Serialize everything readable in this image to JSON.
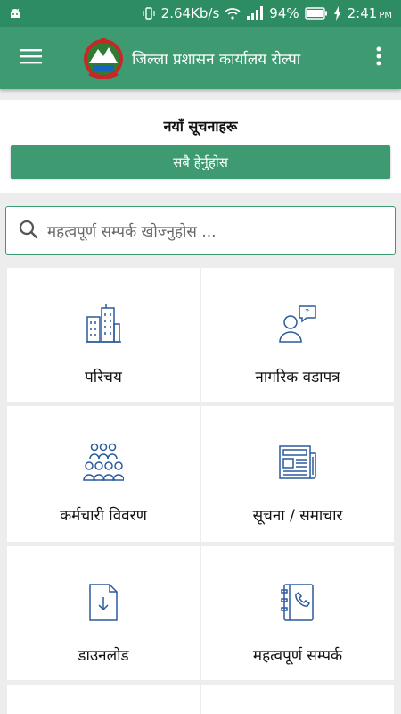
{
  "status_bar": {
    "speed": "2.64Kb/s",
    "battery": "94%",
    "time": "2:41",
    "ampm": "PM"
  },
  "app_bar": {
    "title": "जिल्ला प्रशासन कार्यालय रोल्पा"
  },
  "notice": {
    "title": "नयाँ सूचनाहरू",
    "button_label": "सबै हेर्नुहोस"
  },
  "search": {
    "placeholder": "महत्वपूर्ण सम्पर्क खोज्नुहोस ..."
  },
  "tiles": [
    {
      "label": "परिचय",
      "icon": "buildings-icon"
    },
    {
      "label": "नागरिक वडापत्र",
      "icon": "person-question-icon"
    },
    {
      "label": "कर्मचारी विवरण",
      "icon": "group-people-icon"
    },
    {
      "label": "सूचना / समाचार",
      "icon": "newspaper-icon"
    },
    {
      "label": "डाउनलोड",
      "icon": "download-file-icon"
    },
    {
      "label": "महत्वपूर्ण सम्पर्क",
      "icon": "phone-book-icon"
    }
  ],
  "colors": {
    "primary": "#3d9a71",
    "status_bar": "#2e8c63",
    "icon_blue": "#2a5a9c"
  }
}
